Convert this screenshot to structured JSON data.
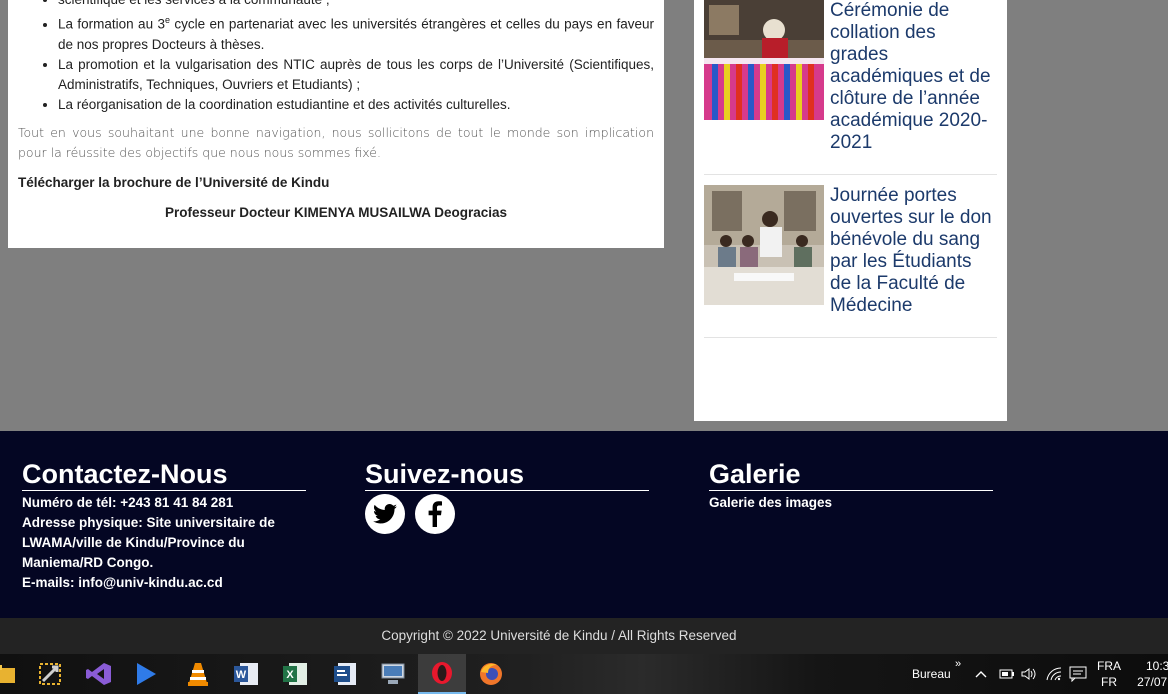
{
  "article": {
    "bullets": [
      "scientifique et les services à la communauté ;",
      "La formation au 3",
      "e",
      " cycle en partenariat avec les universités étrangères et celles du pays en faveur de nos propres Docteurs à thèses.",
      "La promotion et la vulgarisation des NTIC auprès de tous les corps de l’Université (Scientifiques, Administratifs, Techniques, Ouvriers et Etudiants) ;",
      "La réorganisation de la coordination estudiantine et des activités culturelles."
    ],
    "closing": "Tout en vous souhaitant une bonne navigation, nous sollicitons de tout le monde son implication pour la réussite des objectifs que nous nous sommes fixé.",
    "download_label": "Télécharger la brochure de l’Université de Kindu",
    "signature": "Professeur Docteur KIMENYA MUSAILWA Deogracias"
  },
  "sidebar": {
    "news": [
      {
        "title": "Cérémonie de collation des grades académiques et de clôture de l’année académique 2020-2021"
      },
      {
        "title": "Journée portes ouvertes sur le don bénévole du sang par les Étudiants de la Faculté de Médecine"
      }
    ]
  },
  "footer": {
    "contact": {
      "heading": "Contactez-Nous",
      "phone": "Numéro de tél: +243 81 41 84 281",
      "address": "Adresse physique: Site universitaire de LWAMA/ville de Kindu/Province du Maniema/RD Congo.",
      "email": "E-mails: info@univ-kindu.ac.cd"
    },
    "follow": {
      "heading": "Suivez-nous"
    },
    "gallery": {
      "heading": "Galerie",
      "link": "Galerie des images"
    },
    "copyright": "Copyright © 2022 Université de Kindu / All Rights Reserved"
  },
  "taskbar": {
    "apps": [
      "file-explorer-icon",
      "visual-studio-installer-icon",
      "visual-studio-icon",
      "media-player-icon",
      "vlc-icon",
      "word-icon",
      "excel-icon",
      "project-icon",
      "network-app-icon",
      "opera-icon",
      "firefox-icon"
    ],
    "toolbar_label": "Bureau",
    "toolbar_chevron": "»",
    "language_top": "FRA",
    "language_bottom": "FR",
    "time": "10:3",
    "date": "27/07"
  },
  "colors": {
    "footer_bg": "#040623",
    "news_title": "#1c3a6b",
    "copyright_bg": "#232323",
    "page_bg": "#7f7f7f"
  }
}
